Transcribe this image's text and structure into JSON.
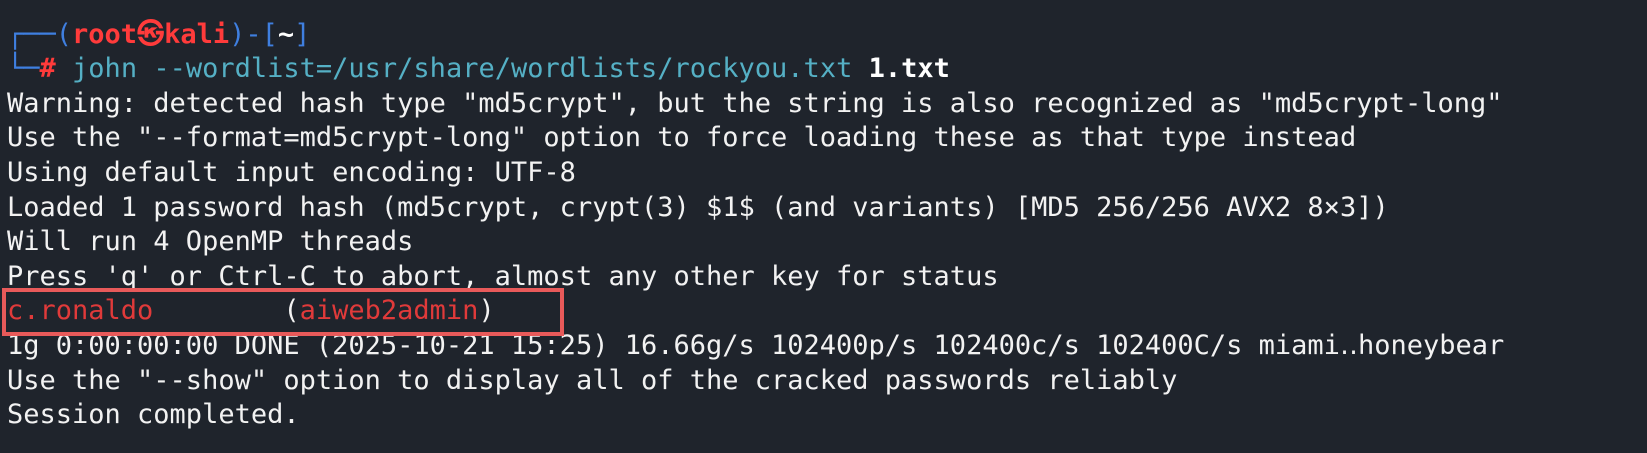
{
  "prompt": {
    "corner_top": "┌──(",
    "user": "root",
    "at_symbol": "㉿",
    "host": "kali",
    "mid": ")-[",
    "cwd": "~",
    "close": "]",
    "corner_bottom": "└─",
    "hash": "#"
  },
  "command": {
    "program": "john",
    "args": "--wordlist=/usr/share/wordlists/rockyou.txt",
    "file": "1.txt"
  },
  "output": {
    "line1": "Warning: detected hash type \"md5crypt\", but the string is also recognized as \"md5crypt-long\"",
    "line2": "Use the \"--format=md5crypt-long\" option to force loading these as that type instead",
    "line3": "Using default input encoding: UTF-8",
    "line4": "Loaded 1 password hash (md5crypt, crypt(3) $1$ (and variants) [MD5 256/256 AVX2 8×3])",
    "line5": "Will run 4 OpenMP threads",
    "line6": "Press 'q' or Ctrl-C to abort, almost any other key for status",
    "cracked_password": "c.ronaldo",
    "cracked_spacer": "        (",
    "cracked_user": "aiweb2admin",
    "cracked_close": ")",
    "line8": "1g 0:00:00:00 DONE (2025-10-21 15:25) 16.66g/s 102400p/s 102400c/s 102400C/s miami‥honeybear",
    "line9": "Use the \"--show\" option to display all of the cracked passwords reliably",
    "line10": "Session completed."
  },
  "colors": {
    "background": "#1f242c",
    "prompt_blue": "#3f7fe0",
    "prompt_red": "#ff3b3b",
    "command_cyan": "#55b0c5",
    "cracked_red": "#e03a3a",
    "highlight_border": "#e85a5a"
  }
}
